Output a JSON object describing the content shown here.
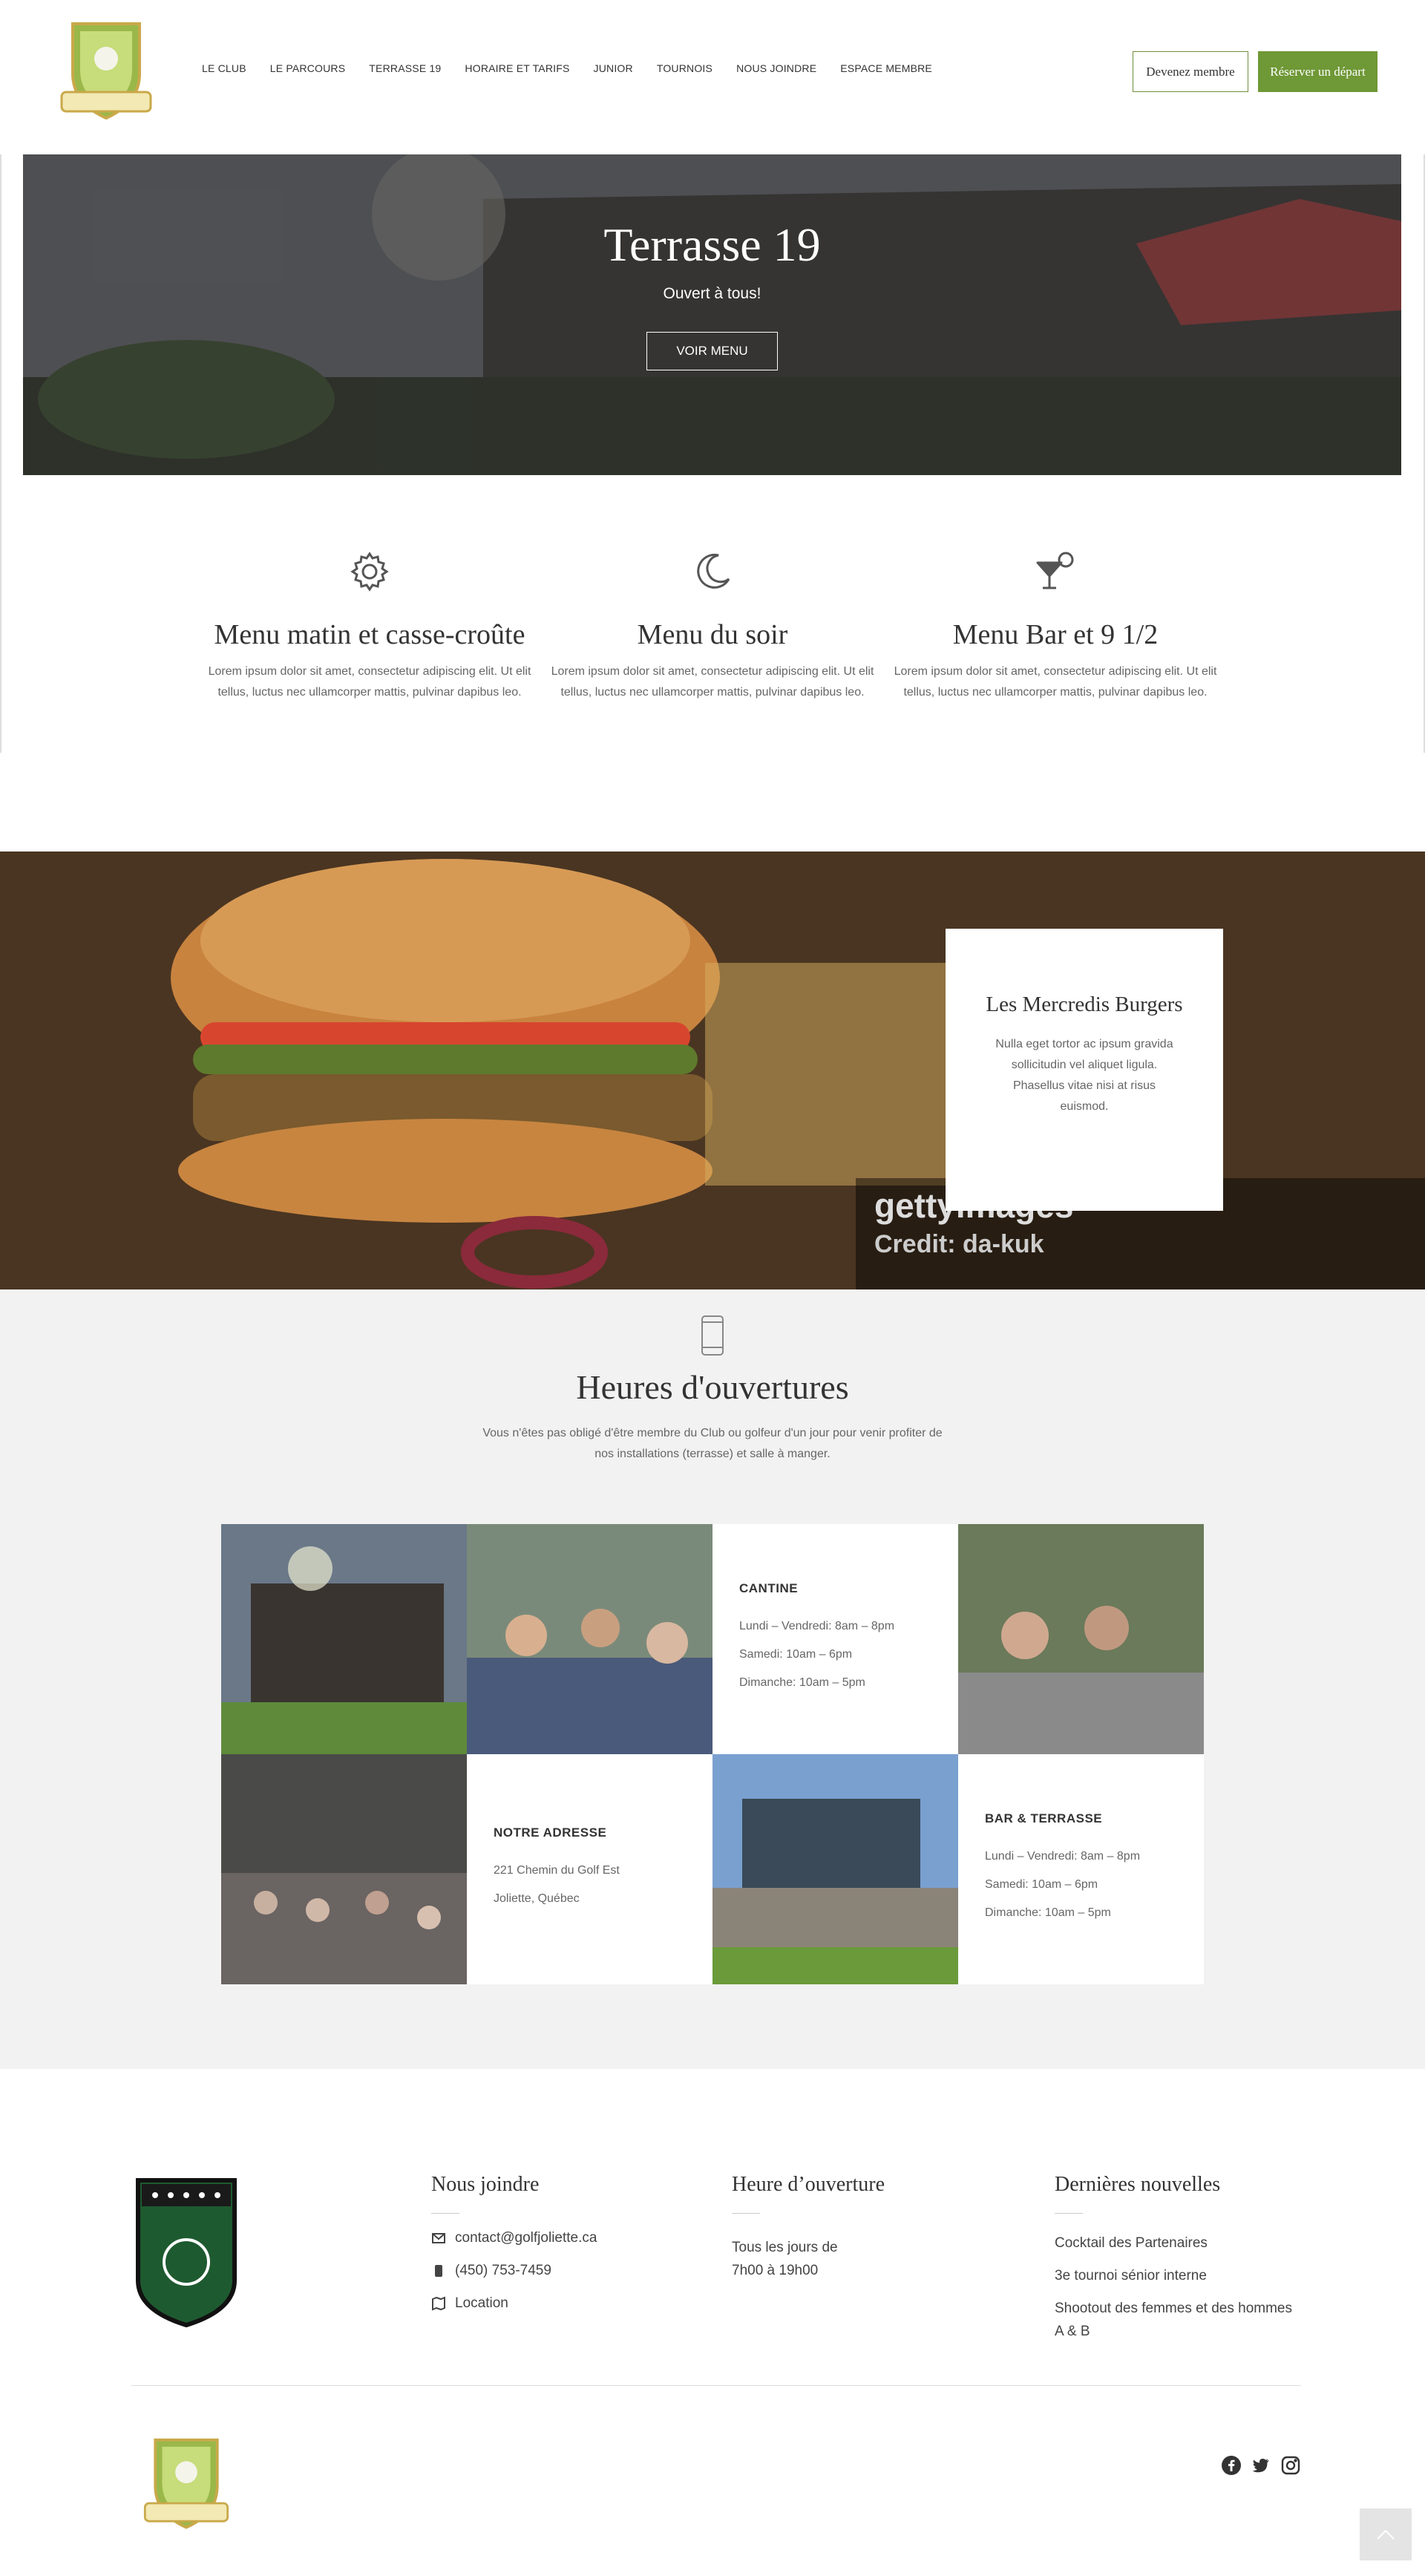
{
  "header": {
    "logo_alt": "Golf Joliette",
    "nav": [
      "LE CLUB",
      "LE PARCOURS",
      "TERRASSE 19",
      "HORAIRE ET TARIFS",
      "JUNIOR",
      "TOURNOIS",
      "NOUS JOINDRE",
      "ESPACE MEMBRE"
    ],
    "btn_member": "Devenez membre",
    "btn_book": "Réserver un départ"
  },
  "hero": {
    "title": "Terrasse 19",
    "subtitle": "Ouvert à tous!",
    "button": "VOIR MENU"
  },
  "features": [
    {
      "icon": "gear-icon",
      "title": "Menu matin et casse-croûte",
      "text": "Lorem ipsum dolor sit amet, consectetur adipiscing elit. Ut elit tellus, luctus nec ullamcorper mattis, pulvinar dapibus leo."
    },
    {
      "icon": "moon-icon",
      "title": "Menu du soir",
      "text": "Lorem ipsum dolor sit amet, consectetur adipiscing elit. Ut elit tellus, luctus nec ullamcorper mattis, pulvinar dapibus leo."
    },
    {
      "icon": "cocktail-icon",
      "title": "Menu Bar et 9 1/2",
      "text": "Lorem ipsum dolor sit amet, consectetur adipiscing elit. Ut elit tellus, luctus nec ullamcorper mattis, pulvinar dapibus leo."
    }
  ],
  "burger": {
    "card_title": "Les Mercredis Burgers",
    "card_text": "Nulla eget tortor ac ipsum gravida sollicitudin vel aliquet ligula. Phasellus vitae nisi at risus euismod.",
    "watermark": "gettyimages",
    "credit": "Credit: da-kuk"
  },
  "hours": {
    "title": "Heures d'ouvertures",
    "text": "Vous n'êtes pas obligé d'être membre du Club ou golfeur d'un jour pour venir profiter de nos installations (terrasse) et salle à manger.",
    "cantine": {
      "title": "CANTINE",
      "lines": [
        "Lundi – Vendredi: 8am – 8pm",
        "Samedi: 10am – 6pm",
        "Dimanche: 10am – 5pm"
      ]
    },
    "adresse": {
      "title": "NOTRE ADRESSE",
      "lines": [
        "221 Chemin du Golf Est",
        "Joliette, Québec"
      ]
    },
    "bar": {
      "title": "BAR & TERRASSE",
      "lines": [
        "Lundi – Vendredi: 8am – 8pm",
        "Samedi: 10am – 6pm",
        "Dimanche: 10am – 5pm"
      ]
    }
  },
  "footer": {
    "contact_title": "Nous joindre",
    "email": "contact@golfjoliette.ca",
    "phone": "(450) 753-7459",
    "location": "Location",
    "hours_title": "Heure d’ouverture",
    "hours_lines": [
      "Tous les jours de",
      "7h00 à 19h00"
    ],
    "news_title": "Dernières nouvelles",
    "news": [
      "Cocktail des Partenaires",
      "3e tournoi sénior interne",
      "Shootout des femmes et des hommes A & B"
    ],
    "social": [
      "facebook-icon",
      "twitter-icon",
      "instagram-icon"
    ]
  },
  "colors": {
    "accent_green": "#6f9836",
    "text": "#333333",
    "bg_grey": "#f2f2f2"
  }
}
